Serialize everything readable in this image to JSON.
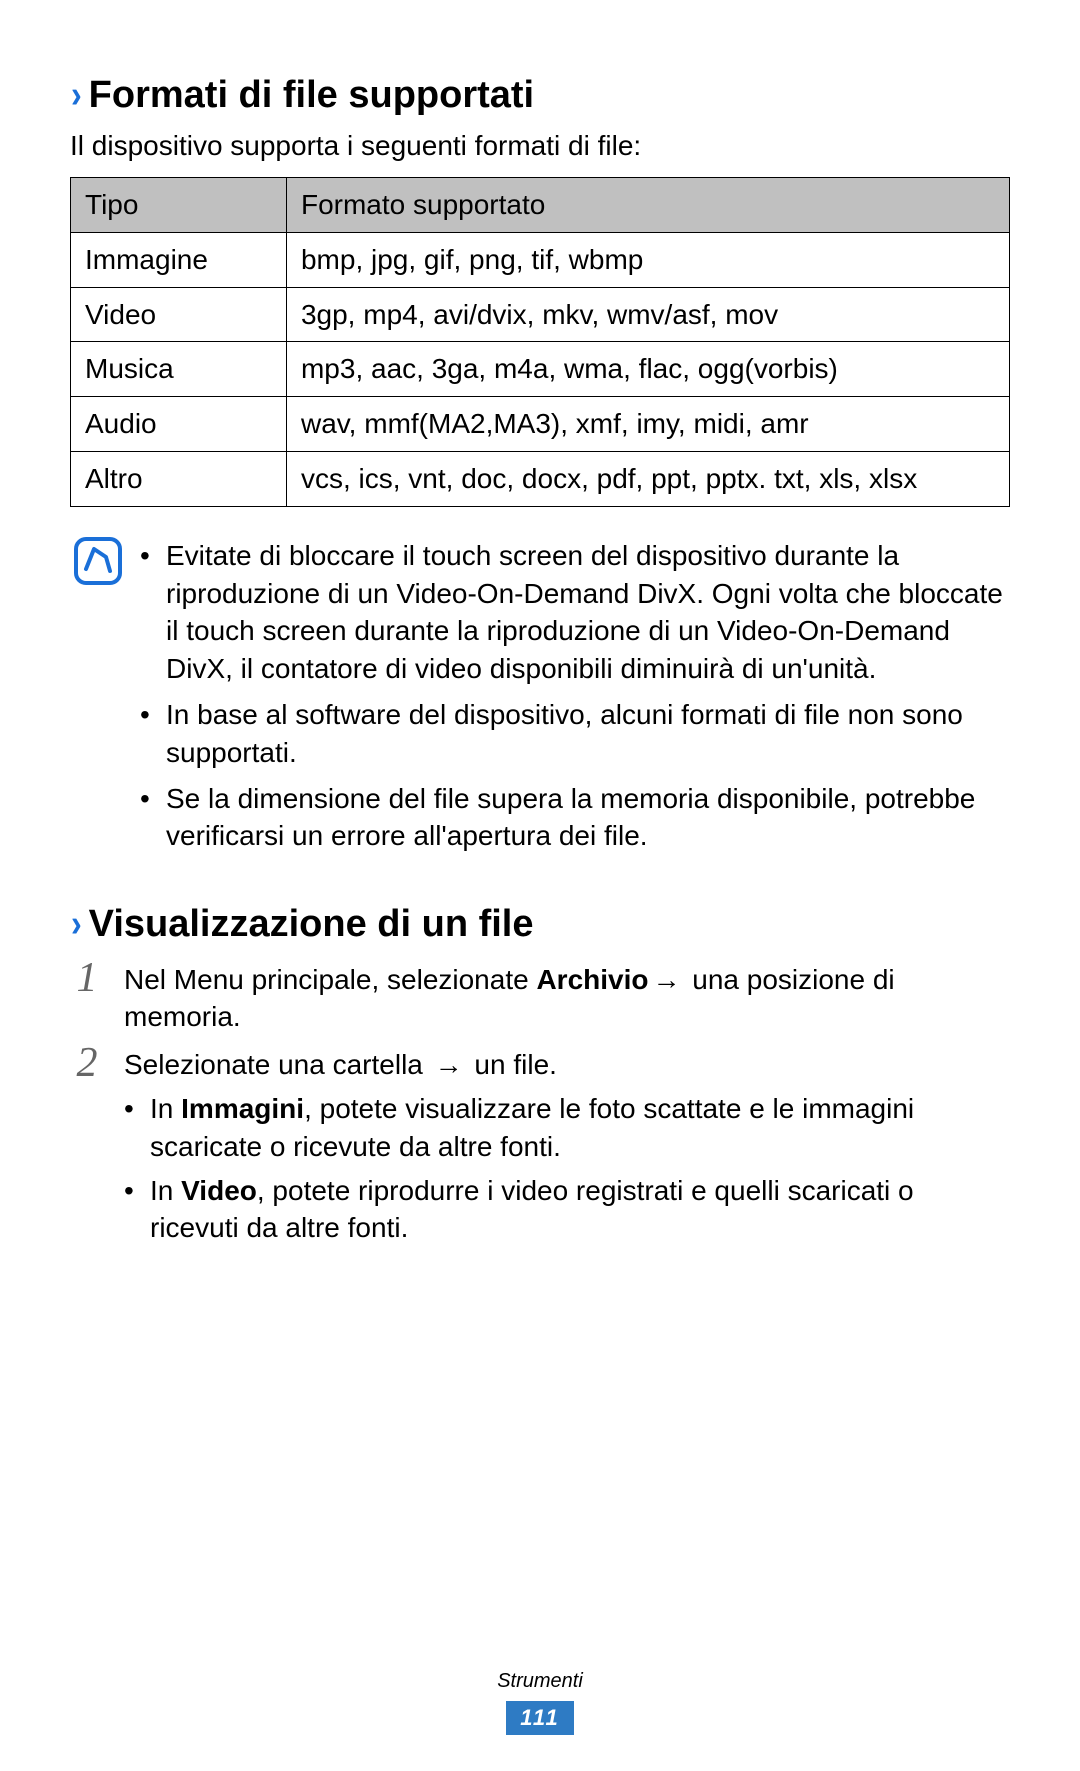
{
  "section1": {
    "heading": "Formati di file supportati",
    "intro": "Il dispositivo supporta i seguenti formati di file:",
    "table": {
      "header": {
        "c1": "Tipo",
        "c2": "Formato supportato"
      },
      "rows": [
        {
          "c1": "Immagine",
          "c2": "bmp, jpg, gif, png, tif, wbmp"
        },
        {
          "c1": "Video",
          "c2": "3gp, mp4, avi/dvix, mkv, wmv/asf, mov"
        },
        {
          "c1": "Musica",
          "c2": "mp3, aac, 3ga, m4a, wma, flac, ogg(vorbis)"
        },
        {
          "c1": "Audio",
          "c2": "wav, mmf(MA2,MA3), xmf, imy, midi, amr"
        },
        {
          "c1": "Altro",
          "c2": "vcs, ics, vnt, doc, docx, pdf, ppt, pptx. txt, xls, xlsx"
        }
      ]
    },
    "notes": [
      "Evitate di bloccare il touch screen del dispositivo durante la riproduzione di un Video-On-Demand DivX. Ogni volta che bloccate il touch screen durante la riproduzione di un Video-On-Demand DivX, il contatore di video disponibili diminuirà di un'unità.",
      "In base al software del dispositivo, alcuni formati di file non sono supportati.",
      "Se la dimensione del file supera la memoria disponibile, potrebbe verificarsi un errore all'apertura dei file."
    ]
  },
  "section2": {
    "heading": "Visualizzazione di un file",
    "step1": {
      "pre": "Nel Menu principale, selezionate ",
      "bold": "Archivio",
      "arrow": "→",
      "post": " una posizione di memoria."
    },
    "step2": {
      "pre": "Selezionate una cartella ",
      "arrow": "→",
      "post": " un file.",
      "bullets": [
        {
          "pre": "In ",
          "bold": "Immagini",
          "post": ", potete visualizzare le foto scattate e le immagini scaricate o ricevute da altre fonti."
        },
        {
          "pre": "In ",
          "bold": "Video",
          "post": ", potete riprodurre i video registrati e quelli scaricati o ricevuti da altre fonti."
        }
      ]
    }
  },
  "footer": {
    "label": "Strumenti",
    "page": "111"
  }
}
